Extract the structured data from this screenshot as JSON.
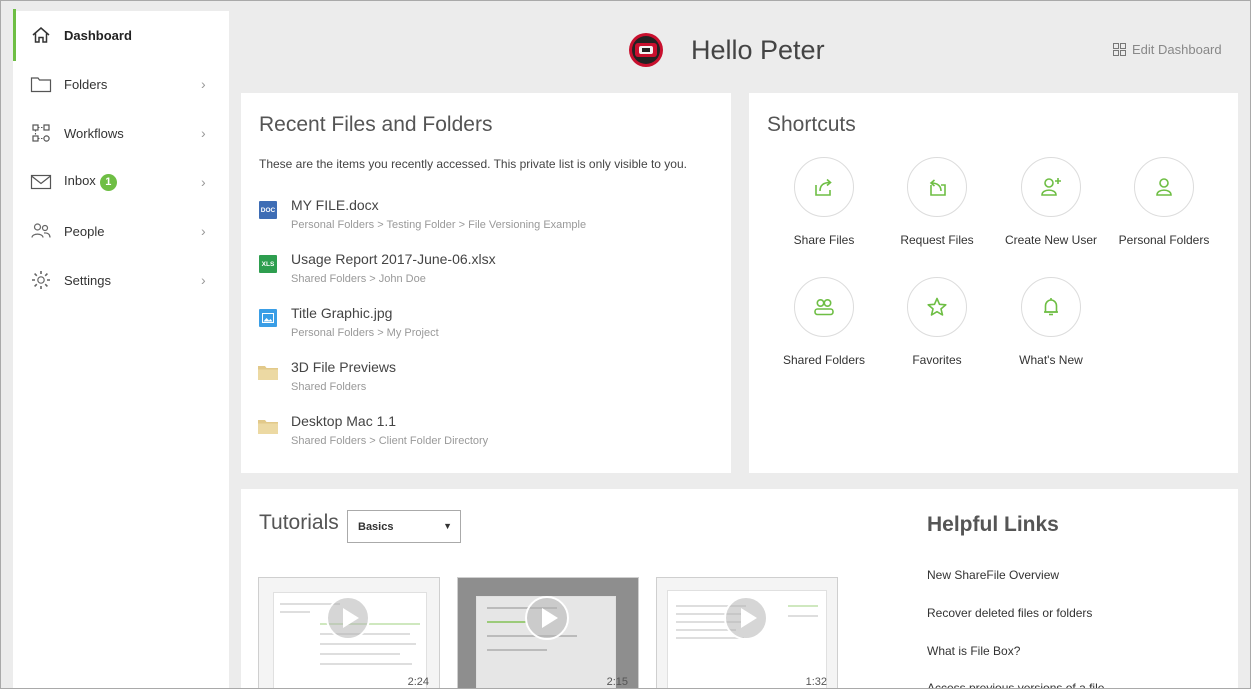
{
  "sidebar": {
    "items": [
      {
        "label": "Dashboard",
        "icon": "home-icon",
        "active": true
      },
      {
        "label": "Folders",
        "icon": "folder-icon"
      },
      {
        "label": "Workflows",
        "icon": "workflow-icon"
      },
      {
        "label": "Inbox",
        "icon": "mail-icon",
        "badge": "1"
      },
      {
        "label": "People",
        "icon": "people-icon"
      },
      {
        "label": "Settings",
        "icon": "gear-icon"
      }
    ],
    "chevron": "›"
  },
  "header": {
    "greeting": "Hello Peter",
    "edit_label": "Edit Dashboard"
  },
  "recent": {
    "title": "Recent Files and Folders",
    "description": "These are the items you recently accessed. This private list is only visible to you.",
    "files": [
      {
        "name": "MY FILE.docx",
        "path": "Personal Folders > Testing Folder > File Versioning Example",
        "type_label": "DOC",
        "color": "#3e6db5"
      },
      {
        "name": "Usage Report 2017-June-06.xlsx",
        "path": "Shared Folders > John Doe",
        "type_label": "XLS",
        "color": "#2e9e4f"
      },
      {
        "name": "Title Graphic.jpg",
        "path": "Personal Folders > My Project",
        "type_label": "",
        "color": "#3a9ee6"
      },
      {
        "name": "3D File Previews",
        "path": "Shared Folders",
        "type_label": "",
        "color": "#e2c98a"
      },
      {
        "name": "Desktop Mac 1.1",
        "path": "Shared Folders > Client Folder Directory",
        "type_label": "",
        "color": "#e2c98a"
      }
    ]
  },
  "shortcuts": {
    "title": "Shortcuts",
    "items": [
      {
        "label": "Share Files",
        "icon": "share-icon"
      },
      {
        "label": "Request Files",
        "icon": "request-icon"
      },
      {
        "label": "Create New User",
        "icon": "add-user-icon"
      },
      {
        "label": "Personal Folders",
        "icon": "user-icon"
      },
      {
        "label": "Shared Folders",
        "icon": "users-icon"
      },
      {
        "label": "Favorites",
        "icon": "star-icon"
      },
      {
        "label": "What's New",
        "icon": "bell-icon"
      }
    ]
  },
  "tutorials": {
    "title": "Tutorials",
    "selected": "Basics",
    "videos": [
      {
        "duration": "2:24"
      },
      {
        "duration": "2:15"
      },
      {
        "duration": "1:32"
      }
    ]
  },
  "helpful": {
    "title": "Helpful Links",
    "links": [
      "New ShareFile Overview",
      "Recover deleted files or folders",
      "What is File Box?",
      "Access previous versions of a file"
    ]
  },
  "colors": {
    "accent": "#6ebe44",
    "avatar": "#c8102e"
  }
}
